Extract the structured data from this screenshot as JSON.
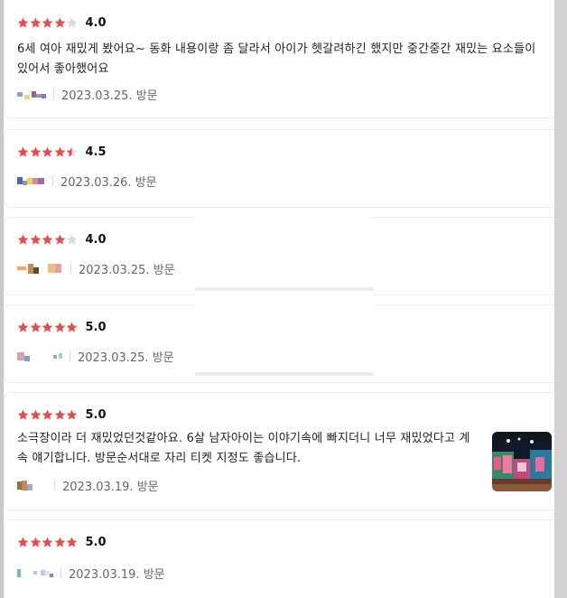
{
  "colors": {
    "star_filled": "#e74c4c",
    "star_empty": "#dadada"
  },
  "reviews": [
    {
      "stars": [
        1,
        1,
        1,
        1,
        0
      ],
      "score": "4.0",
      "text": "6세 여아 재밌게 봤어요~ 동화 내용이랑 좀 달라서 아이가 헷갈려하긴 했지만 중간중간 재밌는 요소들이 있어서 좋아했어요",
      "date": "2023.03.25. 방문"
    },
    {
      "stars": [
        1,
        1,
        1,
        1,
        0.5
      ],
      "score": "4.5",
      "text": "",
      "date": "2023.03.26. 방문"
    },
    {
      "stars": [
        1,
        1,
        1,
        1,
        0
      ],
      "score": "4.0",
      "text": "",
      "date": "2023.03.25. 방문"
    },
    {
      "stars": [
        1,
        1,
        1,
        1,
        1
      ],
      "score": "5.0",
      "text": "",
      "date": "2023.03.25. 방문"
    },
    {
      "stars": [
        1,
        1,
        1,
        1,
        1
      ],
      "score": "5.0",
      "text": "소극장이라 더 재밌었던것같아요. 6살 남자아이는 이야기속에 빠지더니 너무 재밌었다고 계속 얘기합니다. 방문순서대로 자리 티켓 지정도 좋습니다.",
      "date": "2023.03.19. 방문",
      "photo_icon": "theater-stage-photo"
    },
    {
      "stars": [
        1,
        1,
        1,
        1,
        1
      ],
      "score": "5.0",
      "text": "",
      "date": "2023.03.19. 방문"
    }
  ]
}
